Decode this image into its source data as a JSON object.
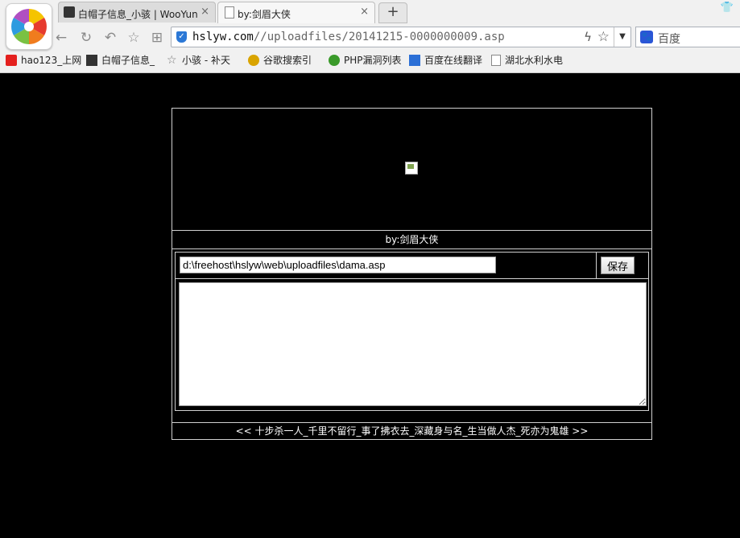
{
  "browser": {
    "tabs": [
      {
        "label": "白帽子信息_小骇 | WooYun",
        "close": "×"
      },
      {
        "label": "by:剑眉大侠",
        "close": "×"
      }
    ],
    "new_tab": "+",
    "window_icon": "👕",
    "address": {
      "host": "hslyw.com",
      "path": "//uploadfiles/20141215-0000000009.asp"
    },
    "search_placeholder": "百度",
    "bookmarks": [
      {
        "label": "hao123_上网",
        "icon": "hao123-icon"
      },
      {
        "label": "白帽子信息_",
        "icon": "wooyun-icon"
      },
      {
        "label": "小骇 - 补天",
        "icon": "star-icon"
      },
      {
        "label": "谷歌搜索引",
        "icon": "google-icon"
      },
      {
        "label": "PHP漏洞列表",
        "icon": "frog-icon"
      },
      {
        "label": "百度在线翻译",
        "icon": "translate-icon"
      },
      {
        "label": "湖北水利水电",
        "icon": "page-icon"
      }
    ]
  },
  "page": {
    "title_line": "by:剑眉大侠",
    "file_path": "d:\\freehost\\hslyw\\web\\uploadfiles\\dama.asp",
    "save_label": "保存",
    "editor_content": "",
    "footer": "<< 十步杀一人_千里不留行_事了拂衣去_深藏身与名_生当做人杰_死亦为鬼雄 >>"
  }
}
